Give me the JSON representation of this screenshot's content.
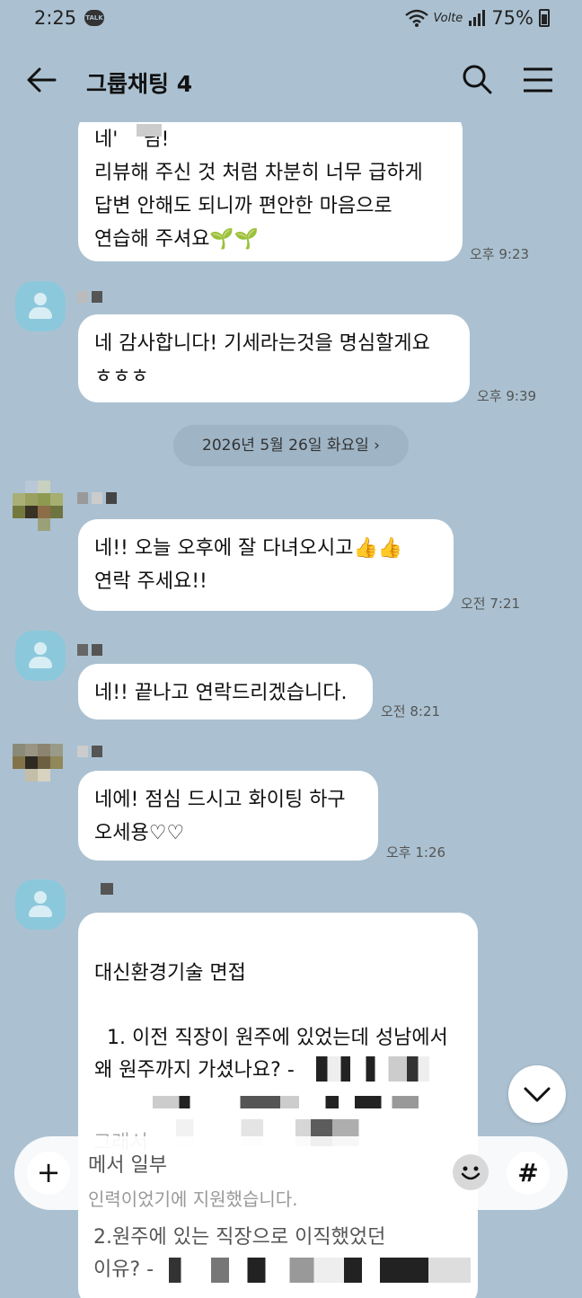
{
  "status": {
    "time": "2:25",
    "talk": "TALK",
    "network": "Volte",
    "battery": "75%"
  },
  "header": {
    "title": "그룹채팅 4"
  },
  "messages": [
    {
      "text": "네'    님!\n리뷰해 주신 것 처럼 차분히 너무 급하게\n답변 안해도 되니까 편안한 마음으로\n연습해 주셔요🌱🌱",
      "time": "오후 9:23"
    },
    {
      "text": "네 감사합니다! 기세라는것을 명심할게요\nㅎㅎㅎ",
      "time": "오후 9:39"
    },
    {
      "text": "네!! 오늘 오후에 잘 다녀오시고👍👍\n연락 주세요!!",
      "time": "오전 7:21"
    },
    {
      "text": "네!! 끝나고 연락드리겠습니다.",
      "time": "오전 8:21"
    },
    {
      "text": "네에! 점심 드시고 화이팅 하구\n오세용♡♡",
      "time": "오후 1:26"
    },
    {
      "text": "\n대신환경기술 면접\n\n  1. 이전 직장이 원주에 있었는데 성남에서\n왜 원주까지 가셨나요? -",
      "time": ""
    }
  ],
  "date_divider": "2026년 5월 26일 화요일  ›",
  "behind_composer": [
    "그래서",
    "메서 일부",
    "인력이었기에 지원했습니다.",
    "  2.원주에 있는 직장으로 이직했었던",
    "이유? -"
  ],
  "composer": {
    "plus": "+",
    "hash": "#"
  },
  "colors": {
    "background": "#abc1d1",
    "bubble": "#ffffff",
    "avatar": "#8cc8db"
  }
}
